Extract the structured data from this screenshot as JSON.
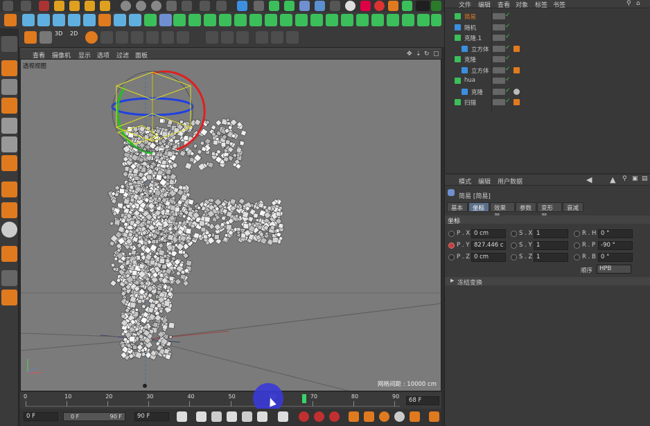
{
  "viewport": {
    "menu": [
      "查看",
      "摄像机",
      "显示",
      "选项",
      "过滤",
      "面板"
    ],
    "label": "透视视图",
    "grid_info": "网格间距 : 10000 cm"
  },
  "timeline": {
    "ticks": [
      "0",
      "10",
      "20",
      "30",
      "40",
      "50",
      "60",
      "70",
      "80",
      "90"
    ],
    "current_frame": "68 F",
    "playhead_value": 68,
    "end_value": 90
  },
  "playbar": {
    "start_field": "0 F",
    "range_start": "0 F",
    "range_end": "90 F",
    "end_field": "90 F"
  },
  "object_manager": {
    "menu": [
      "文件",
      "编辑",
      "查看",
      "对象",
      "标签",
      "书签"
    ],
    "objects": [
      {
        "name": "简易",
        "indent": 0,
        "highlight": true
      },
      {
        "name": "随机",
        "indent": 0,
        "highlight": false
      },
      {
        "name": "克隆.1",
        "indent": 0,
        "highlight": false
      },
      {
        "name": "立方体",
        "indent": 1,
        "highlight": false
      },
      {
        "name": "克隆",
        "indent": 0,
        "highlight": false
      },
      {
        "name": "立方体",
        "indent": 1,
        "highlight": false
      },
      {
        "name": "hua",
        "indent": 0,
        "highlight": false
      },
      {
        "name": "克隆",
        "indent": 1,
        "highlight": false
      },
      {
        "name": "扫描",
        "indent": 0,
        "highlight": false
      }
    ]
  },
  "attributes": {
    "menu": [
      "模式",
      "编辑",
      "用户数据"
    ],
    "object_title": "简易 [简易]",
    "tabs": [
      "基本",
      "坐标",
      "效果器",
      "参数",
      "变形器",
      "衰减"
    ],
    "active_tab": "坐标",
    "section": "坐标",
    "fields": {
      "px_label": "P . X",
      "px": "0 cm",
      "py_label": "P . Y",
      "py": "827.446 c",
      "pz_label": "P . Z",
      "pz": "0 cm",
      "sx_label": "S . X",
      "sx": "1",
      "sy_label": "S . Y",
      "sy": "1",
      "sz_label": "S . Z",
      "sz": "1",
      "rh_label": "R . H",
      "rh": "0 °",
      "rp_label": "R . P",
      "rp": "-90 °",
      "rb_label": "R . B",
      "rb": "0 °"
    },
    "order_label": "顺序",
    "order_value": "HPB",
    "freeze": "冻结变换"
  },
  "colors": {
    "accent_orange": "#e07a1f",
    "selection_blue": "#5c6f8a",
    "green_playhead": "#39d36b",
    "cursor_highlight": "#3a3ad8"
  }
}
